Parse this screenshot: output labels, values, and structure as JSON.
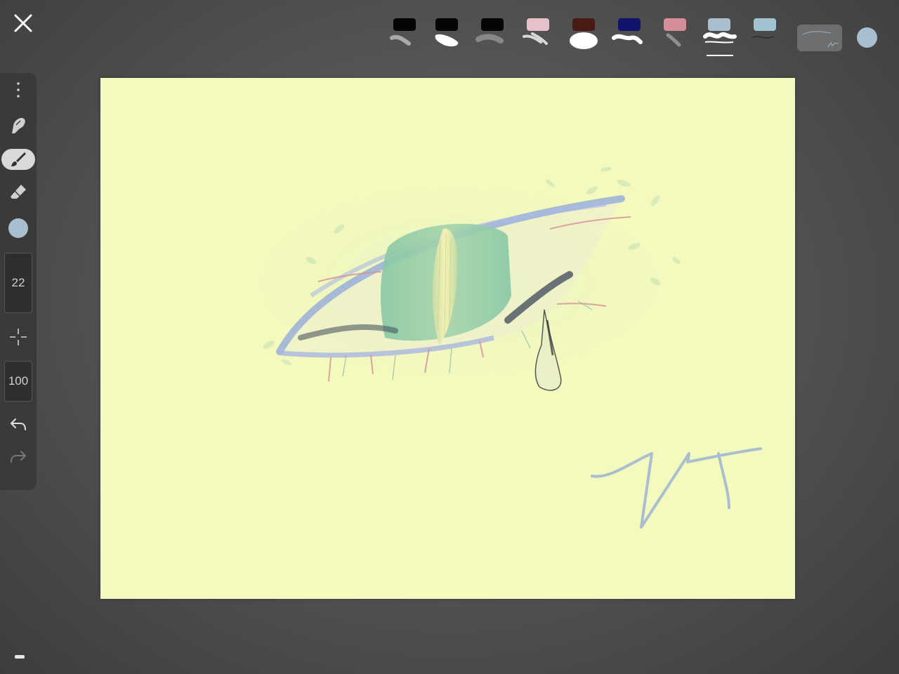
{
  "app": {
    "accent_color": "#a9bfcf",
    "canvas_color": "#f4f9bd"
  },
  "top_bar": {
    "close_icon": "close-icon",
    "brushes": [
      {
        "name": "brush-1",
        "swatch": "#050505"
      },
      {
        "name": "brush-2",
        "swatch": "#050505"
      },
      {
        "name": "brush-3",
        "swatch": "#050505"
      },
      {
        "name": "brush-4",
        "swatch": "#e7c1ca"
      },
      {
        "name": "brush-5",
        "swatch": "#4a1b14"
      },
      {
        "name": "brush-6",
        "swatch": "#10156b"
      },
      {
        "name": "brush-7",
        "swatch": "#d48e97"
      },
      {
        "name": "brush-8",
        "swatch": "#a9bfcf",
        "selected": true
      },
      {
        "name": "brush-9",
        "swatch": "#a3c2cf"
      }
    ],
    "current_color": "#a9bfcf"
  },
  "toolbar": {
    "more_icon": "more-vertical-icon",
    "smudge_icon": "smudge-icon",
    "brush_icon": "brush-icon",
    "eraser_icon": "eraser-icon",
    "color": "#a9bfcf",
    "brush_size": "22",
    "opacity": "100",
    "undo_icon": "undo-icon",
    "redo_icon": "redo-icon"
  }
}
